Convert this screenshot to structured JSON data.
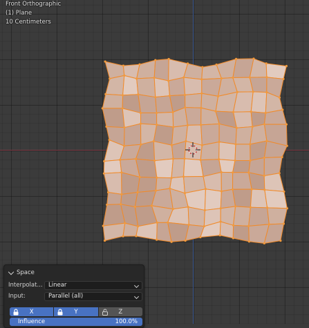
{
  "viewport": {
    "view_name": "Front Orthographic",
    "object_name": "(1) Plane",
    "grid_scale": "10 Centimeters"
  },
  "colors": {
    "background": "#3b3b3b",
    "mesh_face": "#d1b2a2",
    "edge_selected": "#f08a2a",
    "x_axis": "#7e3b45",
    "z_axis": "#3c5890",
    "panel_bg": "#282828",
    "accent_blue": "#4872c2"
  },
  "panel": {
    "title": "Space",
    "interpolation_label": "Interpolat...",
    "interpolation_value": "Linear",
    "input_label": "Input:",
    "input_value": "Parallel (all)",
    "axes": [
      {
        "label": "X",
        "active": true,
        "locked": true
      },
      {
        "label": "Y",
        "active": true,
        "locked": true
      },
      {
        "label": "Z",
        "active": false,
        "locked": false
      }
    ],
    "influence_label": "Influence",
    "influence_value": "100.0%",
    "influence_fraction": 1.0
  }
}
